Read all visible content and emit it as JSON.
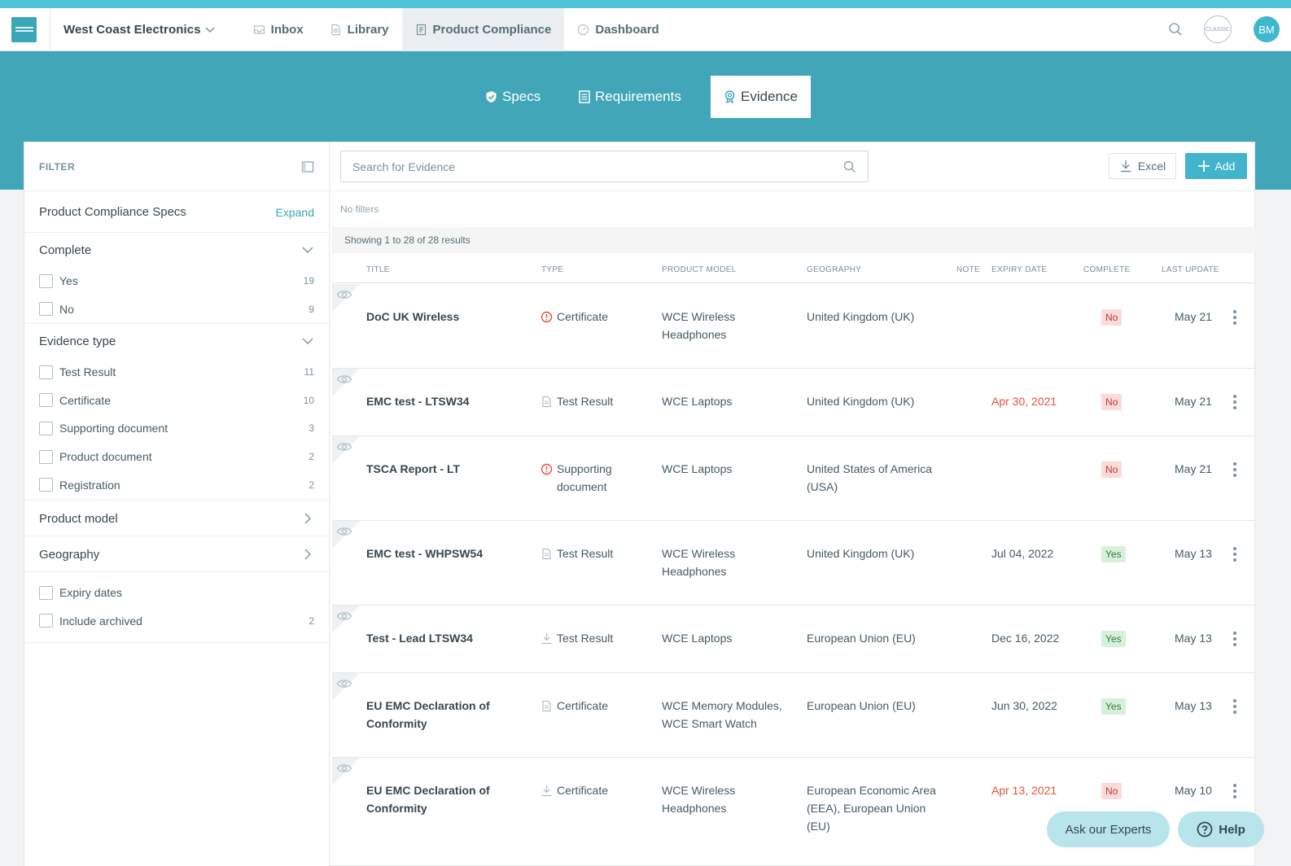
{
  "topnav": {
    "company": "West Coast Electronics",
    "items": [
      {
        "label": "Inbox",
        "icon": "inbox-icon"
      },
      {
        "label": "Library",
        "icon": "library-icon"
      },
      {
        "label": "Product Compliance",
        "icon": "compliance-icon"
      },
      {
        "label": "Dashboard",
        "icon": "dashboard-icon"
      }
    ],
    "classic_label": "CLASSIC",
    "avatar_initials": "BM"
  },
  "subtabs": [
    {
      "label": "Specs",
      "icon": "shield-check-icon"
    },
    {
      "label": "Requirements",
      "icon": "list-doc-icon"
    },
    {
      "label": "Evidence",
      "icon": "badge-icon"
    }
  ],
  "filter": {
    "header": "FILTER",
    "specs_title": "Product Compliance Specs",
    "expand_label": "Expand",
    "complete": {
      "title": "Complete",
      "options": [
        {
          "label": "Yes",
          "count": "19"
        },
        {
          "label": "No",
          "count": "9"
        }
      ]
    },
    "evidence_type": {
      "title": "Evidence type",
      "options": [
        {
          "label": "Test Result",
          "count": "11"
        },
        {
          "label": "Certificate",
          "count": "10"
        },
        {
          "label": "Supporting document",
          "count": "3"
        },
        {
          "label": "Product document",
          "count": "2"
        },
        {
          "label": "Registration",
          "count": "2"
        }
      ]
    },
    "product_model_title": "Product model",
    "geography_title": "Geography",
    "expiry_label": "Expiry dates",
    "archived_label": "Include archived",
    "archived_count": "2"
  },
  "toolbar": {
    "search_placeholder": "Search for Evidence",
    "excel_label": "Excel",
    "add_label": "Add"
  },
  "no_filters": "No filters",
  "showing": "Showing 1 to 28 of 28 results",
  "columns": {
    "title": "TITLE",
    "type": "TYPE",
    "product_model": "PRODUCT MODEL",
    "geography": "GEOGRAPHY",
    "note": "NOTE",
    "expiry": "EXPIRY DATE",
    "complete": "COMPLETE",
    "last_update": "LAST UPDATE"
  },
  "rows": [
    {
      "title": "DoC UK Wireless",
      "type": "Certificate",
      "type_icon": "alert-circle-icon",
      "model": "WCE Wireless Headphones",
      "geo": "United Kingdom (UK)",
      "expiry": "",
      "expired": false,
      "complete": "No",
      "updated": "May 21"
    },
    {
      "title": "EMC test - LTSW34",
      "type": "Test Result",
      "type_icon": "file-icon",
      "model": "WCE Laptops",
      "geo": "United Kingdom (UK)",
      "expiry": "Apr 30, 2021",
      "expired": true,
      "complete": "No",
      "updated": "May 21"
    },
    {
      "title": "TSCA Report - LT",
      "type": "Supporting document",
      "type_icon": "alert-circle-icon",
      "model": "WCE Laptops",
      "geo": "United States of America (USA)",
      "expiry": "",
      "expired": false,
      "complete": "No",
      "updated": "May 21"
    },
    {
      "title": "EMC test - WHPSW54",
      "type": "Test Result",
      "type_icon": "file-icon",
      "model": "WCE Wireless Headphones",
      "geo": "United Kingdom (UK)",
      "expiry": "Jul 04, 2022",
      "expired": false,
      "complete": "Yes",
      "updated": "May 13"
    },
    {
      "title": "Test - Lead LTSW34",
      "type": "Test Result",
      "type_icon": "download-icon",
      "model": "WCE Laptops",
      "geo": "European Union (EU)",
      "expiry": "Dec 16, 2022",
      "expired": false,
      "complete": "Yes",
      "updated": "May 13"
    },
    {
      "title": "EU EMC Declaration of Conformity",
      "type": "Certificate",
      "type_icon": "file-icon",
      "model": "WCE Memory Modules, WCE Smart Watch",
      "geo": "European Union (EU)",
      "expiry": "Jun 30, 2022",
      "expired": false,
      "complete": "Yes",
      "updated": "May 13"
    },
    {
      "title": "EU EMC Declaration of Conformity",
      "type": "Certificate",
      "type_icon": "download-icon",
      "model": "WCE Wireless Headphones",
      "geo": "European Economic Area (EEA), European Union (EU)",
      "expiry": "Apr 13, 2021",
      "expired": true,
      "complete": "No",
      "updated": "May 10"
    }
  ],
  "fab": {
    "experts_label": "Ask our Experts",
    "help_label": "Help"
  },
  "colors": {
    "accent": "#41a7b8",
    "stripe": "#4fc3d7",
    "add_button": "#42b4cb",
    "danger": "#e5533d"
  }
}
